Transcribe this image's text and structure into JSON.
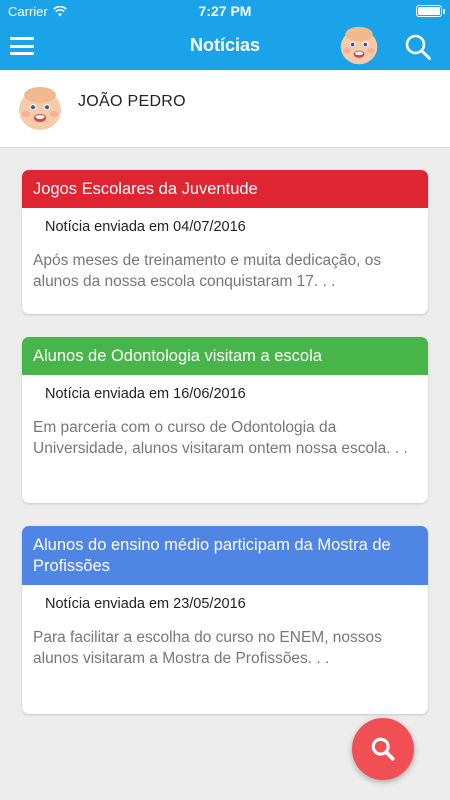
{
  "statusbar": {
    "carrier": "Carrier",
    "time": "7:27 PM"
  },
  "navbar": {
    "title": "Notícias"
  },
  "profile": {
    "name": "JOÃO PEDRO"
  },
  "news": [
    {
      "title": "Jogos Escolares da Juventude",
      "date_text": "Notícia enviada em 04/07/2016",
      "excerpt": "Após meses de treinamento e muita dedicação, os alunos da nossa escola conquistaram 17. . .",
      "color": "#e02532"
    },
    {
      "title": "Alunos de Odontologia visitam a escola",
      "date_text": "Notícia enviada em 16/06/2016",
      "excerpt": "Em parceria com o curso de Odontologia da Universidade, alunos visitaram ontem nossa escola. . .",
      "color": "#48b54a"
    },
    {
      "title": "Alunos do ensino médio participam da Mostra de Profissões",
      "date_text": "Notícia enviada em 23/05/2016",
      "excerpt": "Para facilitar a escolha do curso no ENEM, nossos alunos visitaram a Mostra de Profissões. . .",
      "color": "#4f86e6"
    }
  ],
  "colors": {
    "header": "#1aa3e8",
    "background": "#ececec",
    "fab": "#f24f55"
  },
  "icons": {
    "menu": "hamburger-icon",
    "search": "search-icon",
    "wifi": "wifi-icon",
    "battery": "battery-icon",
    "avatar": "baby-face-avatar"
  }
}
